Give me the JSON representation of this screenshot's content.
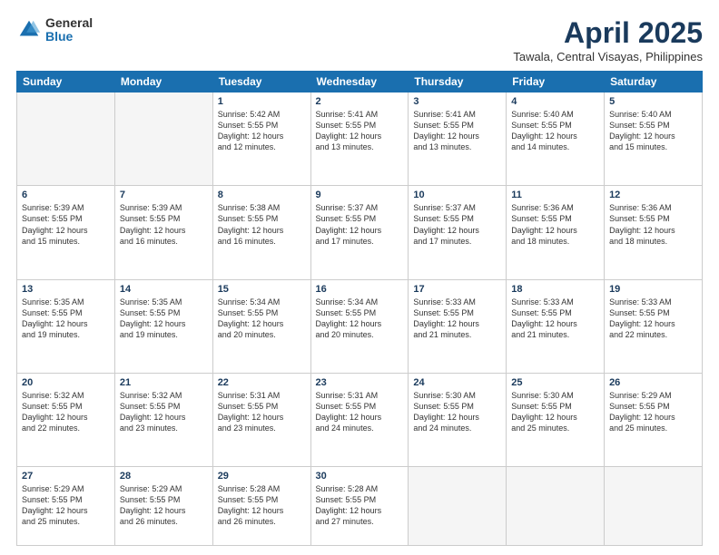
{
  "logo": {
    "general": "General",
    "blue": "Blue"
  },
  "title": "April 2025",
  "subtitle": "Tawala, Central Visayas, Philippines",
  "headers": [
    "Sunday",
    "Monday",
    "Tuesday",
    "Wednesday",
    "Thursday",
    "Friday",
    "Saturday"
  ],
  "rows": [
    [
      {
        "day": "",
        "info": ""
      },
      {
        "day": "",
        "info": ""
      },
      {
        "day": "1",
        "info": "Sunrise: 5:42 AM\nSunset: 5:55 PM\nDaylight: 12 hours\nand 12 minutes."
      },
      {
        "day": "2",
        "info": "Sunrise: 5:41 AM\nSunset: 5:55 PM\nDaylight: 12 hours\nand 13 minutes."
      },
      {
        "day": "3",
        "info": "Sunrise: 5:41 AM\nSunset: 5:55 PM\nDaylight: 12 hours\nand 13 minutes."
      },
      {
        "day": "4",
        "info": "Sunrise: 5:40 AM\nSunset: 5:55 PM\nDaylight: 12 hours\nand 14 minutes."
      },
      {
        "day": "5",
        "info": "Sunrise: 5:40 AM\nSunset: 5:55 PM\nDaylight: 12 hours\nand 15 minutes."
      }
    ],
    [
      {
        "day": "6",
        "info": "Sunrise: 5:39 AM\nSunset: 5:55 PM\nDaylight: 12 hours\nand 15 minutes."
      },
      {
        "day": "7",
        "info": "Sunrise: 5:39 AM\nSunset: 5:55 PM\nDaylight: 12 hours\nand 16 minutes."
      },
      {
        "day": "8",
        "info": "Sunrise: 5:38 AM\nSunset: 5:55 PM\nDaylight: 12 hours\nand 16 minutes."
      },
      {
        "day": "9",
        "info": "Sunrise: 5:37 AM\nSunset: 5:55 PM\nDaylight: 12 hours\nand 17 minutes."
      },
      {
        "day": "10",
        "info": "Sunrise: 5:37 AM\nSunset: 5:55 PM\nDaylight: 12 hours\nand 17 minutes."
      },
      {
        "day": "11",
        "info": "Sunrise: 5:36 AM\nSunset: 5:55 PM\nDaylight: 12 hours\nand 18 minutes."
      },
      {
        "day": "12",
        "info": "Sunrise: 5:36 AM\nSunset: 5:55 PM\nDaylight: 12 hours\nand 18 minutes."
      }
    ],
    [
      {
        "day": "13",
        "info": "Sunrise: 5:35 AM\nSunset: 5:55 PM\nDaylight: 12 hours\nand 19 minutes."
      },
      {
        "day": "14",
        "info": "Sunrise: 5:35 AM\nSunset: 5:55 PM\nDaylight: 12 hours\nand 19 minutes."
      },
      {
        "day": "15",
        "info": "Sunrise: 5:34 AM\nSunset: 5:55 PM\nDaylight: 12 hours\nand 20 minutes."
      },
      {
        "day": "16",
        "info": "Sunrise: 5:34 AM\nSunset: 5:55 PM\nDaylight: 12 hours\nand 20 minutes."
      },
      {
        "day": "17",
        "info": "Sunrise: 5:33 AM\nSunset: 5:55 PM\nDaylight: 12 hours\nand 21 minutes."
      },
      {
        "day": "18",
        "info": "Sunrise: 5:33 AM\nSunset: 5:55 PM\nDaylight: 12 hours\nand 21 minutes."
      },
      {
        "day": "19",
        "info": "Sunrise: 5:33 AM\nSunset: 5:55 PM\nDaylight: 12 hours\nand 22 minutes."
      }
    ],
    [
      {
        "day": "20",
        "info": "Sunrise: 5:32 AM\nSunset: 5:55 PM\nDaylight: 12 hours\nand 22 minutes."
      },
      {
        "day": "21",
        "info": "Sunrise: 5:32 AM\nSunset: 5:55 PM\nDaylight: 12 hours\nand 23 minutes."
      },
      {
        "day": "22",
        "info": "Sunrise: 5:31 AM\nSunset: 5:55 PM\nDaylight: 12 hours\nand 23 minutes."
      },
      {
        "day": "23",
        "info": "Sunrise: 5:31 AM\nSunset: 5:55 PM\nDaylight: 12 hours\nand 24 minutes."
      },
      {
        "day": "24",
        "info": "Sunrise: 5:30 AM\nSunset: 5:55 PM\nDaylight: 12 hours\nand 24 minutes."
      },
      {
        "day": "25",
        "info": "Sunrise: 5:30 AM\nSunset: 5:55 PM\nDaylight: 12 hours\nand 25 minutes."
      },
      {
        "day": "26",
        "info": "Sunrise: 5:29 AM\nSunset: 5:55 PM\nDaylight: 12 hours\nand 25 minutes."
      }
    ],
    [
      {
        "day": "27",
        "info": "Sunrise: 5:29 AM\nSunset: 5:55 PM\nDaylight: 12 hours\nand 25 minutes."
      },
      {
        "day": "28",
        "info": "Sunrise: 5:29 AM\nSunset: 5:55 PM\nDaylight: 12 hours\nand 26 minutes."
      },
      {
        "day": "29",
        "info": "Sunrise: 5:28 AM\nSunset: 5:55 PM\nDaylight: 12 hours\nand 26 minutes."
      },
      {
        "day": "30",
        "info": "Sunrise: 5:28 AM\nSunset: 5:55 PM\nDaylight: 12 hours\nand 27 minutes."
      },
      {
        "day": "",
        "info": ""
      },
      {
        "day": "",
        "info": ""
      },
      {
        "day": "",
        "info": ""
      }
    ]
  ]
}
